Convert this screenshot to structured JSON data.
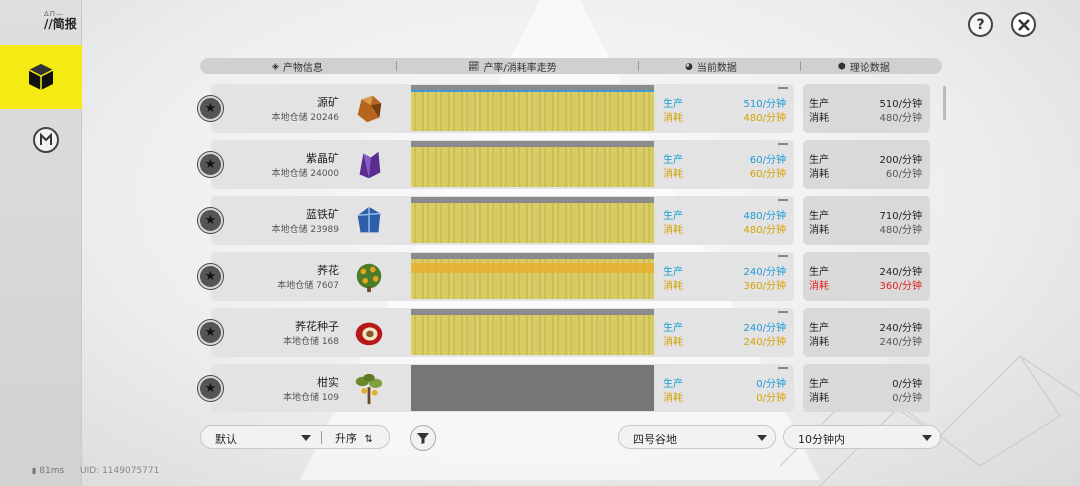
{
  "app": {
    "brief_title": "//简报",
    "ping": "81ms",
    "uid": "UID: 1149075771"
  },
  "header": {
    "col_info": "产物信息",
    "col_trend": "产率/消耗率走势",
    "col_current": "当前数据",
    "col_theory": "理论数据"
  },
  "rows": [
    {
      "name": "源矿",
      "stock": "本地仓储 20246",
      "prod_label": "生产",
      "cons_label": "消耗",
      "cur_prod": "510/分钟",
      "cur_cons": "480/分钟",
      "th_prod": "510/分钟",
      "th_cons": "480/分钟",
      "warn": false,
      "trend": "bar"
    },
    {
      "name": "紫晶矿",
      "stock": "本地仓储 24000",
      "prod_label": "生产",
      "cons_label": "消耗",
      "cur_prod": "60/分钟",
      "cur_cons": "60/分钟",
      "th_prod": "200/分钟",
      "th_cons": "60/分钟",
      "warn": false,
      "trend": "bar"
    },
    {
      "name": "蓝铁矿",
      "stock": "本地仓储 23989",
      "prod_label": "生产",
      "cons_label": "消耗",
      "cur_prod": "480/分钟",
      "cur_cons": "480/分钟",
      "th_prod": "710/分钟",
      "th_cons": "480/分钟",
      "warn": false,
      "trend": "bar"
    },
    {
      "name": "荞花",
      "stock": "本地仓储 7607",
      "prod_label": "生产",
      "cons_label": "消耗",
      "cur_prod": "240/分钟",
      "cur_cons": "360/分钟",
      "th_prod": "240/分钟",
      "th_cons": "360/分钟",
      "warn": true,
      "trend": "bar"
    },
    {
      "name": "荞花种子",
      "stock": "本地仓储 168",
      "prod_label": "生产",
      "cons_label": "消耗",
      "cur_prod": "240/分钟",
      "cur_cons": "240/分钟",
      "th_prod": "240/分钟",
      "th_cons": "240/分钟",
      "warn": false,
      "trend": "bar"
    },
    {
      "name": "柑实",
      "stock": "本地仓储 109",
      "prod_label": "生产",
      "cons_label": "消耗",
      "cur_prod": "0/分钟",
      "cur_cons": "0/分钟",
      "th_prod": "0/分钟",
      "th_cons": "0/分钟",
      "warn": false,
      "trend": "empty"
    }
  ],
  "controls": {
    "sort_value": "默认",
    "order_label": "升序",
    "region_value": "四号谷地",
    "time_value": "10分钟内"
  },
  "colors": {
    "accent": "#f5ea14",
    "produce": "#1d9ad6",
    "consume": "#d4a300",
    "warning": "#e01f1f",
    "trend_fill": "#d6c85a"
  },
  "icons": {
    "sidebar_active": "cube-icon",
    "sidebar_second": "gate-icon",
    "help": "question-icon",
    "close": "close-icon",
    "filter": "funnel-icon"
  }
}
